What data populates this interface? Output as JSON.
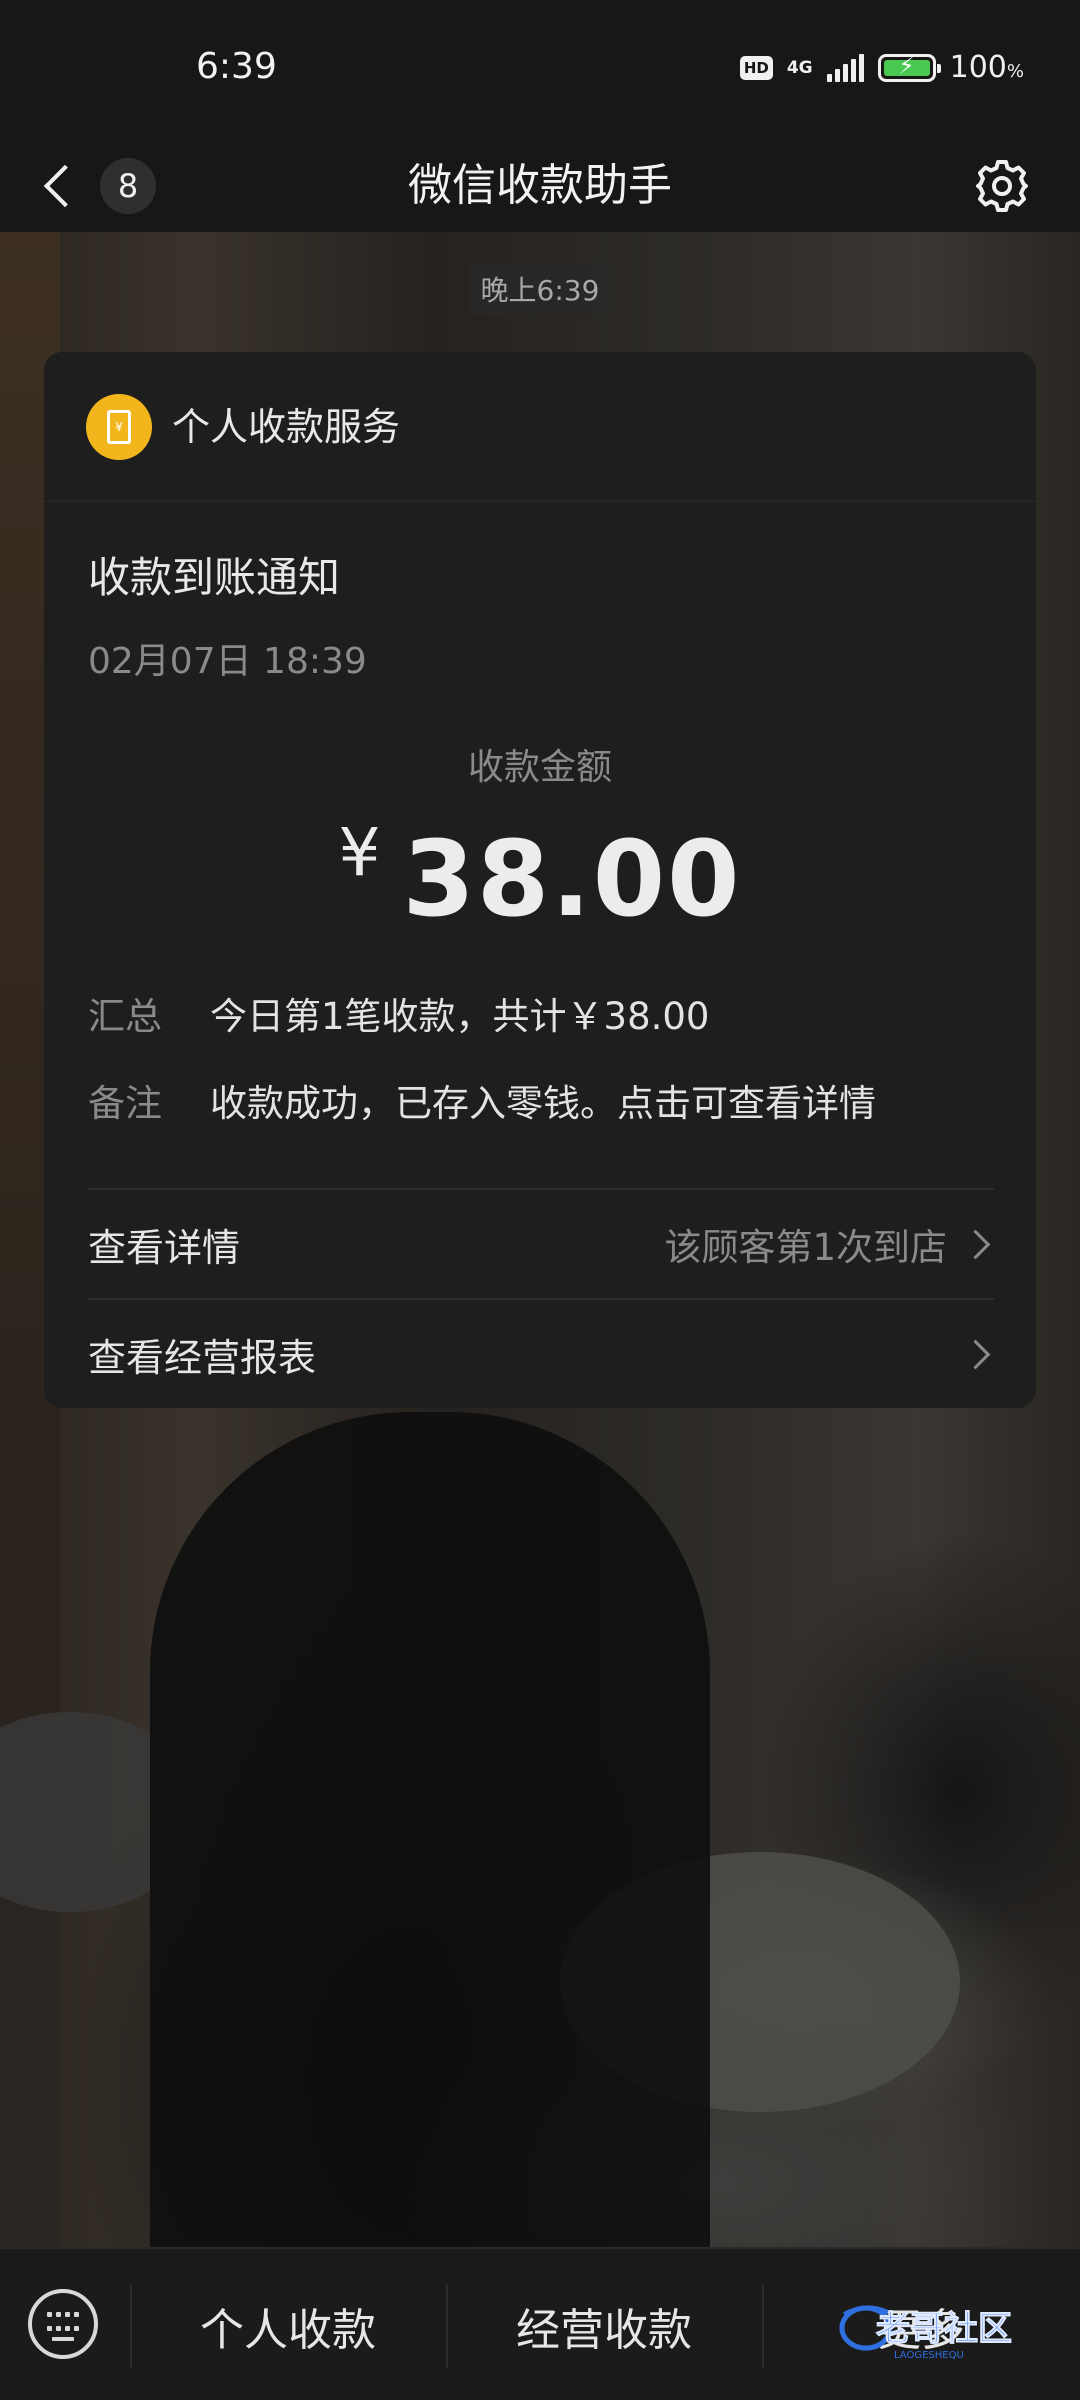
{
  "status_bar": {
    "time": "6:39",
    "hd": "HD",
    "network": "4G",
    "battery_percent": "100",
    "battery_unit": "%"
  },
  "nav": {
    "back_icon": "chevron-left-icon",
    "unread_count": "8",
    "title": "微信收款助手",
    "settings_icon": "gear-icon"
  },
  "chat": {
    "timestamp": "晚上6:39"
  },
  "card": {
    "service_icon": "wallet-yuan-icon",
    "service_name": "个人收款服务",
    "notice_title": "收款到账通知",
    "notice_time": "02月07日 18:39",
    "amount_label": "收款金额",
    "currency": "¥",
    "amount": "38.00",
    "summary_key": "汇总",
    "summary_value": "今日第1笔收款，共计￥38.00",
    "note_key": "备注",
    "note_value": "收款成功，已存入零钱。点击可查看详情",
    "link_details": "查看详情",
    "link_details_hint": "该顾客第1次到店",
    "link_report": "查看经营报表"
  },
  "bottom_menu": {
    "keyboard_icon": "keyboard-icon",
    "items": [
      "个人收款",
      "经营收款",
      "更多"
    ]
  },
  "watermark": {
    "text": "老哥社区",
    "subtext": "LAOGESHEQU"
  },
  "colors": {
    "accent_yellow": "#f2b61c",
    "battery_green": "#49c94f",
    "card_bg": "#1e1e1e",
    "watermark_blue": "#2f6fe0"
  }
}
